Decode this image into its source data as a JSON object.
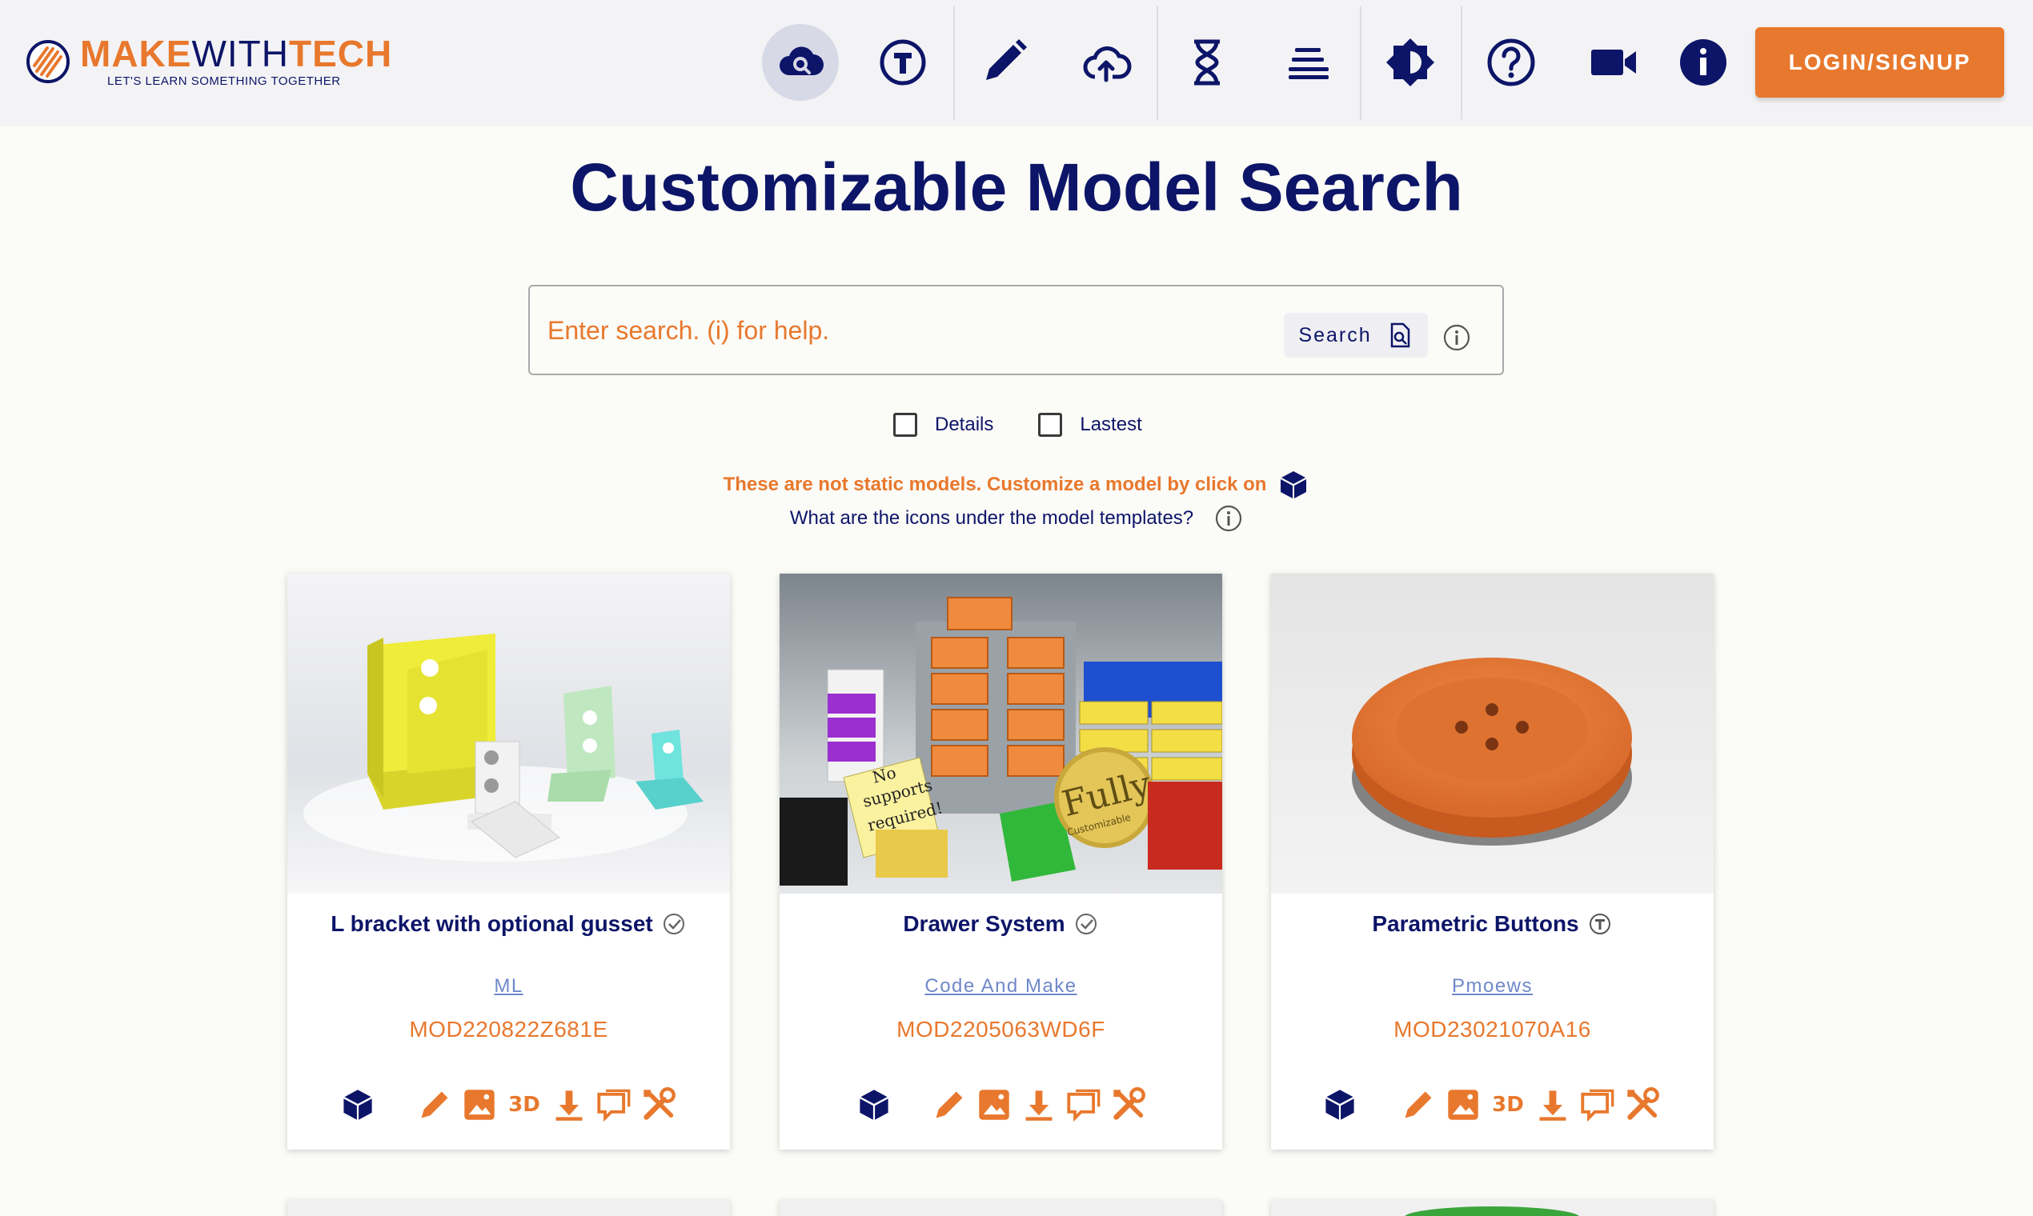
{
  "header": {
    "logo_make": "MAKE",
    "logo_with": "WITH",
    "logo_tech": "TECH",
    "tagline": "LET'S LEARN SOMETHING TOGETHER",
    "nav_icons": [
      "cloud-search-icon",
      "t-circle-icon",
      "pencil-icon",
      "cloud-upload-icon",
      "hourglass-icon",
      "list-icon",
      "brightness-icon",
      "help-circle-icon",
      "video-camera-icon",
      "info-icon"
    ],
    "login_label": "LOGIN/SIGNUP"
  },
  "page_title": "Customizable Model Search",
  "search": {
    "placeholder": "Enter search. (i) for help.",
    "button_label": "Search"
  },
  "filters": {
    "details_label": "Details",
    "latest_label": "Lastest"
  },
  "notice": "These are not static models. Customize a model by click on",
  "help_text": "What are the icons under the model templates?",
  "models": [
    {
      "title": "L bracket with optional gusset",
      "badge": "verified-check-icon",
      "author": "ML",
      "id": "MOD220822Z681E"
    },
    {
      "title": "Drawer System",
      "badge": "verified-check-icon",
      "author": "Code And Make",
      "id": "MOD2205063WD6F"
    },
    {
      "title": "Parametric Buttons",
      "badge": "t-circle-icon",
      "author": "Pmoews",
      "id": "MOD23021070A16"
    }
  ],
  "image_text": {
    "note": [
      "No",
      "supports",
      "required!"
    ],
    "seal_main": "Fully",
    "seal_sub": "Customizable"
  },
  "action_3d_label": "3D",
  "colors": {
    "accent": "#e8782d",
    "primary": "#0d1568",
    "link": "#6f88c9"
  }
}
